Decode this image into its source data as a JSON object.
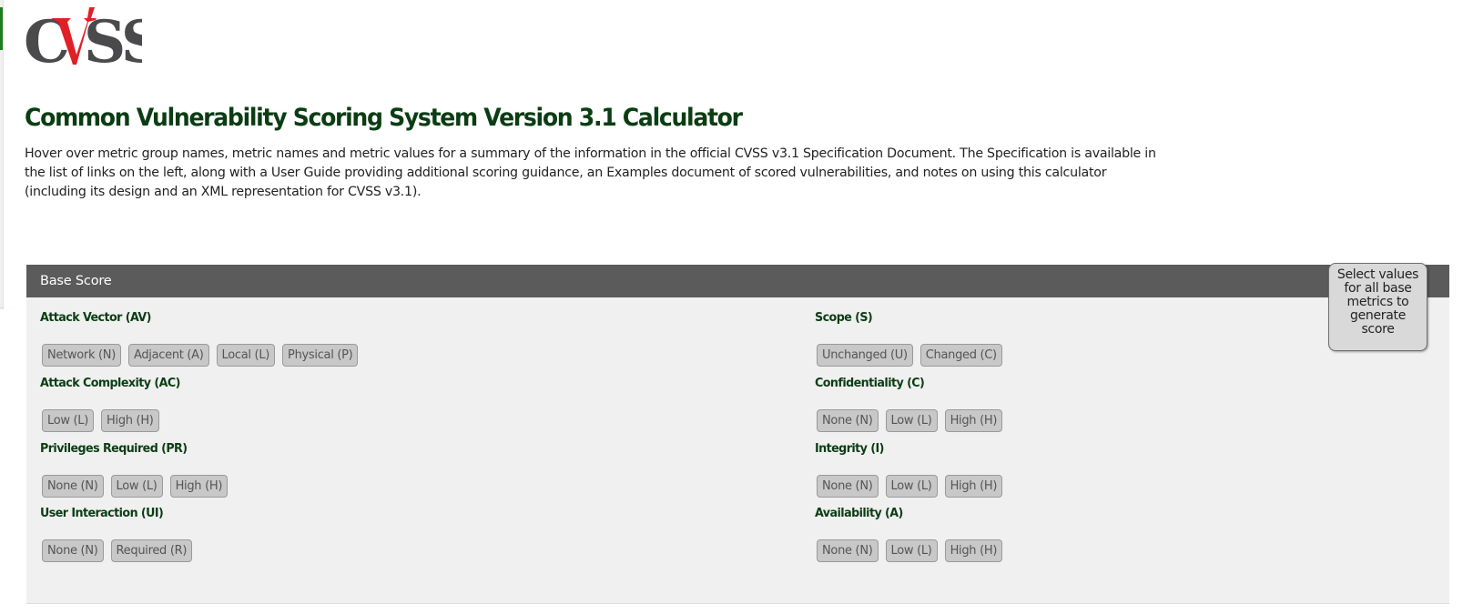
{
  "logo": {
    "text": "CVSS",
    "alt": "CVSS logo",
    "colors": {
      "letters": "#4a4a4c",
      "v_accent": "#e01f26"
    }
  },
  "page": {
    "title": "Common Vulnerability Scoring System Version 3.1 Calculator",
    "intro": "Hover over metric group names, metric names and metric values for a summary of the information in the official CVSS v3.1 Specification Document. The Specification is available in the list of links on the left, along with a User Guide providing additional scoring guidance, an Examples document of scored vulnerabilities, and notes on using this calculator (including its design and an XML representation for CVSS v3.1)."
  },
  "base_score": {
    "header": "Base Score",
    "score_message": "Select values for all base metrics to generate score",
    "left_metrics": [
      {
        "name": "Attack Vector (AV)",
        "options": [
          "Network (N)",
          "Adjacent (A)",
          "Local (L)",
          "Physical (P)"
        ]
      },
      {
        "name": "Attack Complexity (AC)",
        "options": [
          "Low (L)",
          "High (H)"
        ]
      },
      {
        "name": "Privileges Required (PR)",
        "options": [
          "None (N)",
          "Low (L)",
          "High (H)"
        ]
      },
      {
        "name": "User Interaction (UI)",
        "options": [
          "None (N)",
          "Required (R)"
        ]
      }
    ],
    "right_metrics": [
      {
        "name": "Scope (S)",
        "options": [
          "Unchanged (U)",
          "Changed (C)"
        ]
      },
      {
        "name": "Confidentiality (C)",
        "options": [
          "None (N)",
          "Low (L)",
          "High (H)"
        ]
      },
      {
        "name": "Integrity (I)",
        "options": [
          "None (N)",
          "Low (L)",
          "High (H)"
        ]
      },
      {
        "name": "Availability (A)",
        "options": [
          "None (N)",
          "Low (L)",
          "High (H)"
        ]
      }
    ]
  },
  "colors": {
    "heading_green": "#0b3d13",
    "header_bar": "#5b5b5b",
    "panel_bg": "#f0f0f0",
    "button_bg": "#c8c8c8",
    "sidebar_accent": "#1e7d1e"
  }
}
